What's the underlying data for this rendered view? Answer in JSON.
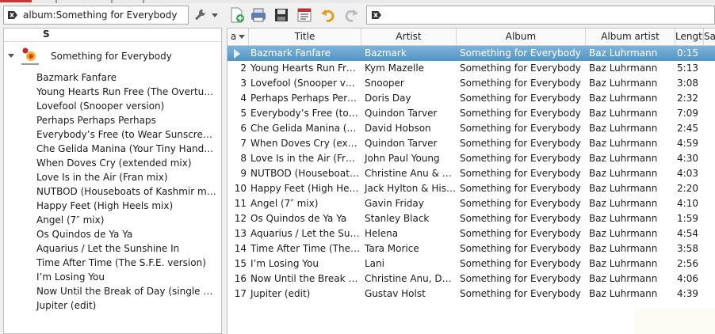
{
  "filter": {
    "value": "album:Something for Everybody",
    "placeholder": ""
  },
  "search": {
    "value": "",
    "placeholder": ""
  },
  "toolbar": {
    "icons": [
      "wrench-icon",
      "new-playlist-icon",
      "load-playlist-icon",
      "save-playlist-icon",
      "playlist-manager-icon",
      "undo-icon",
      "redo-icon"
    ]
  },
  "library": {
    "header": "S",
    "album": "Something for Everybody",
    "tracks": [
      "Bazmark Fanfare",
      "Young Hearts Run Free (The Overture Mix)",
      "Lovefool (Snooper version)",
      "Perhaps Perhaps Perhaps",
      "Everybody’s Free (to Wear Sunscreen) (The Sunscreen Song)",
      "Che Gelida Manina (Your Tiny Hand Is Frozen)",
      "When Doves Cry (extended mix)",
      "Love Is in the Air (Fran mix)",
      "NUTBOD (Houseboats of Kashmir mix)",
      "Happy Feet (High Heels mix)",
      "Angel (7″ mix)",
      "Os Quindos de Ya Ya",
      "Aquarius / Let the Sunshine In",
      "Time After Time (The S.F.E. version)",
      "I’m Losing You",
      "Now Until the Break of Day (single version)",
      "Jupiter (edit)"
    ]
  },
  "table": {
    "columns": {
      "num": "a",
      "title": "Title",
      "artist": "Artist",
      "album": "Album",
      "album_artist": "Album artist",
      "length": "Length",
      "extra": "Sar"
    },
    "rows": [
      {
        "num": "",
        "title": "Bazmark Fanfare",
        "artist": "Bazmark",
        "album": "Something for Everybody",
        "album_artist": "Baz Luhrmann",
        "length": "0:15"
      },
      {
        "num": "2",
        "title": "Young Hearts Run Free (The Overture Mix)",
        "artist": "Kym Mazelle",
        "album": "Something for Everybody",
        "album_artist": "Baz Luhrmann",
        "length": "5:13"
      },
      {
        "num": "3",
        "title": "Lovefool (Snooper version)",
        "artist": "Snooper",
        "album": "Something for Everybody",
        "album_artist": "Baz Luhrmann",
        "length": "3:08"
      },
      {
        "num": "4",
        "title": "Perhaps Perhaps Perhaps",
        "artist": "Doris Day",
        "album": "Something for Everybody",
        "album_artist": "Baz Luhrmann",
        "length": "2:32"
      },
      {
        "num": "5",
        "title": "Everybody’s Free (to Wear Sunscreen)",
        "artist": "Quindon Tarver",
        "album": "Something for Everybody",
        "album_artist": "Baz Luhrmann",
        "length": "7:09"
      },
      {
        "num": "6",
        "title": "Che Gelida Manina (Your Tiny Hand Is Frozen)",
        "artist": "David Hobson",
        "album": "Something for Everybody",
        "album_artist": "Baz Luhrmann",
        "length": "2:45"
      },
      {
        "num": "7",
        "title": "When Doves Cry (extended mix)",
        "artist": "Quindon Tarver",
        "album": "Something for Everybody",
        "album_artist": "Baz Luhrmann",
        "length": "4:59"
      },
      {
        "num": "8",
        "title": "Love Is in the Air (Fran mix)",
        "artist": "John Paul Young",
        "album": "Something for Everybody",
        "album_artist": "Baz Luhrmann",
        "length": "4:30"
      },
      {
        "num": "9",
        "title": "NUTBOD (Houseboats of Kashmir mix)",
        "artist": "Christine Anu & Rob Mills",
        "album": "Something for Everybody",
        "album_artist": "Baz Luhrmann",
        "length": "4:03"
      },
      {
        "num": "10",
        "title": "Happy Feet (High Heels mix)",
        "artist": "Jack Hylton & His Orchestra",
        "album": "Something for Everybody",
        "album_artist": "Baz Luhrmann",
        "length": "2:20"
      },
      {
        "num": "11",
        "title": "Angel (7″ mix)",
        "artist": "Gavin Friday",
        "album": "Something for Everybody",
        "album_artist": "Baz Luhrmann",
        "length": "4:10"
      },
      {
        "num": "12",
        "title": "Os Quindos de Ya Ya",
        "artist": "Stanley Black",
        "album": "Something for Everybody",
        "album_artist": "Baz Luhrmann",
        "length": "1:59"
      },
      {
        "num": "13",
        "title": "Aquarius / Let the Sunshine In",
        "artist": "Helena",
        "album": "Something for Everybody",
        "album_artist": "Baz Luhrmann",
        "length": "4:54"
      },
      {
        "num": "14",
        "title": "Time After Time (The S.F.E. version)",
        "artist": "Tara Morice",
        "album": "Something for Everybody",
        "album_artist": "Baz Luhrmann",
        "length": "3:58"
      },
      {
        "num": "15",
        "title": "I’m Losing You",
        "artist": "Lani",
        "album": "Something for Everybody",
        "album_artist": "Baz Luhrmann",
        "length": "2:56"
      },
      {
        "num": "16",
        "title": "Now Until the Break of Day (single version)",
        "artist": "Christine Anu, David Hobson",
        "album": "Something for Everybody",
        "album_artist": "Baz Luhrmann",
        "length": "4:06"
      },
      {
        "num": "17",
        "title": "Jupiter (edit)",
        "artist": "Gustav Holst",
        "album": "Something for Everybody",
        "album_artist": "Baz Luhrmann",
        "length": "4:39"
      }
    ]
  },
  "colors": {
    "selection_top": "#7fb3d8",
    "selection_bottom": "#4f95c7",
    "undo": "#e0a020"
  }
}
